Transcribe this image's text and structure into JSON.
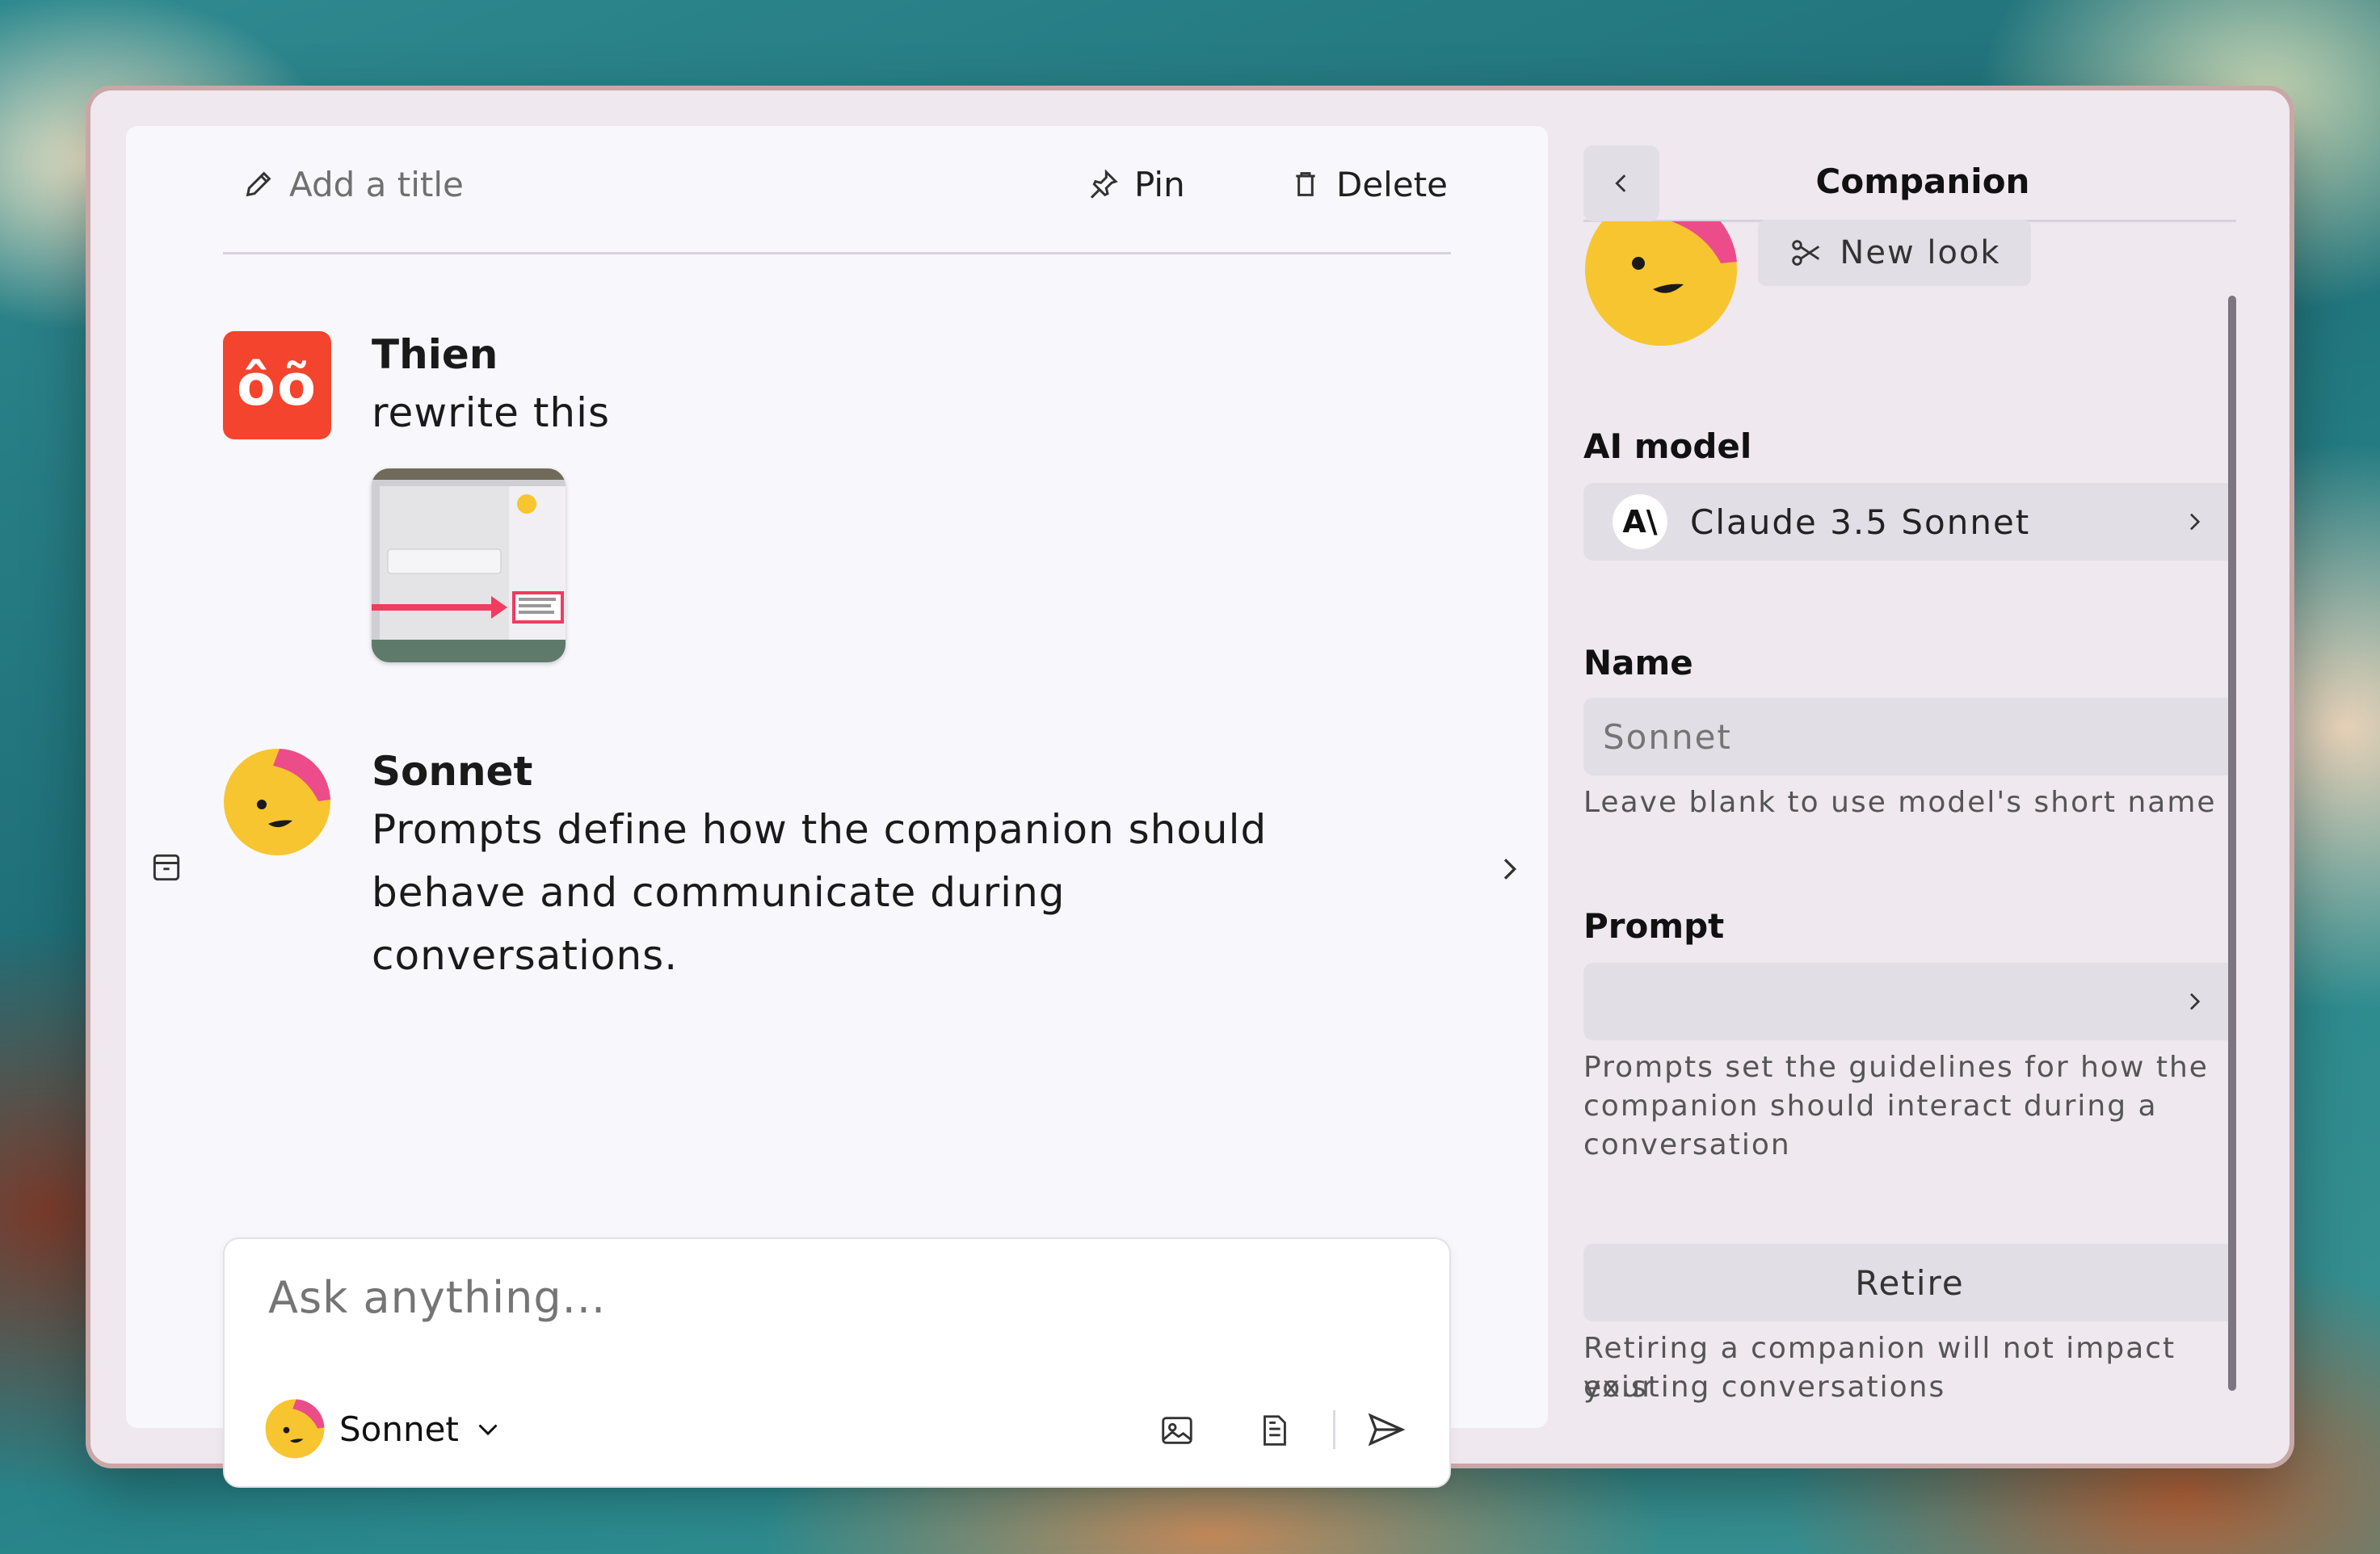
{
  "toolbar": {
    "title_placeholder": "Add a title",
    "pin_label": "Pin",
    "delete_label": "Delete"
  },
  "messages": [
    {
      "author": "Thien",
      "avatar_text": "ôõ",
      "text": "rewrite this",
      "has_image_attachment": true
    },
    {
      "author": "Sonnet",
      "lines": [
        "Prompts define how the companion should",
        "behave and communicate during",
        "conversations."
      ]
    }
  ],
  "composer": {
    "placeholder": "Ask anything...",
    "model_label": "Sonnet"
  },
  "panel": {
    "title": "Companion",
    "new_look_label": "New look",
    "ai_model_label": "AI model",
    "ai_model_value": "Claude 3.5 Sonnet",
    "name_label": "Name",
    "name_placeholder": "Sonnet",
    "name_hint": "Leave blank to use model's short name",
    "prompt_label": "Prompt",
    "prompt_value": "",
    "prompt_hint_lines": [
      "Prompts set the guidelines for how the",
      "companion should interact during a",
      "conversation"
    ],
    "retire_label": "Retire",
    "retire_hint_lines": [
      "Retiring a companion will not impact your",
      "existing conversations"
    ]
  },
  "colors": {
    "thien_avatar": "#f4442e",
    "sonnet_face": "#f7c52f",
    "sonnet_hat": "#ec4c8a",
    "attachment_arrow": "#f03c5f"
  }
}
